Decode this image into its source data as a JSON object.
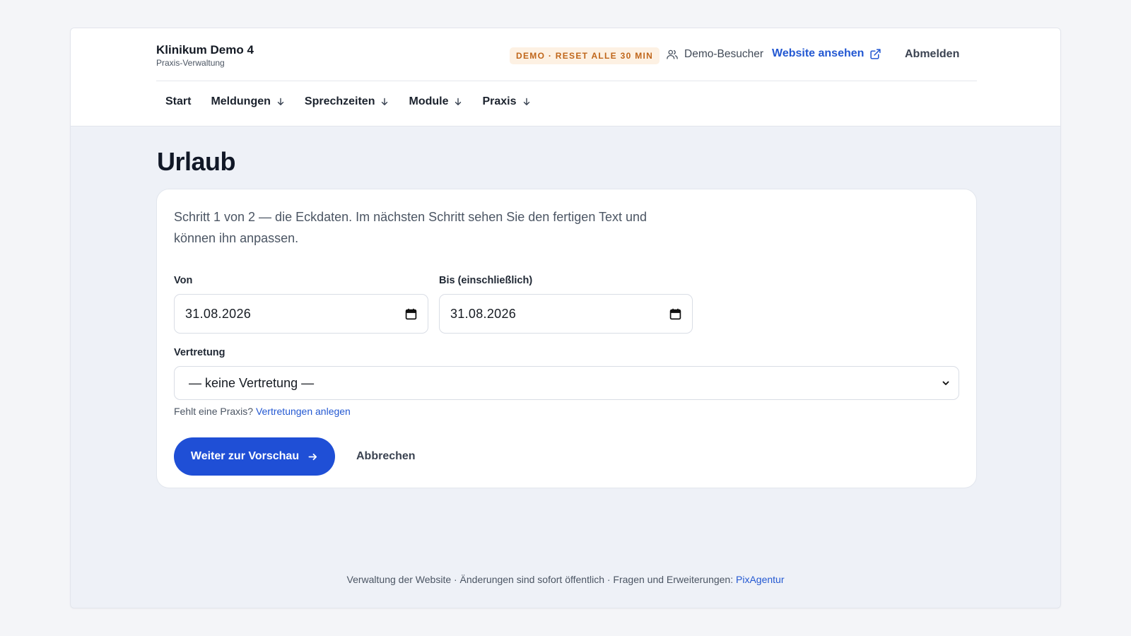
{
  "brand": {
    "title": "Klinikum Demo 4",
    "subtitle": "Praxis-Verwaltung"
  },
  "header": {
    "badge": "DEMO · RESET ALLE 30 MIN",
    "user": "Demo-Besucher",
    "site_link": "Website ansehen",
    "logout": "Abmelden"
  },
  "nav": {
    "items": [
      {
        "label": "Start"
      },
      {
        "label": "Meldungen"
      },
      {
        "label": "Sprechzeiten"
      },
      {
        "label": "Module"
      },
      {
        "label": "Praxis"
      }
    ]
  },
  "page": {
    "title": "Urlaub"
  },
  "form": {
    "intro": "Schritt 1 von 2 — die Eckdaten. Im nächsten Schritt sehen Sie den fertigen Text und können ihn anpassen.",
    "from_label": "Von",
    "from_value": "31.08.2026",
    "to_label": "Bis (einschließlich)",
    "to_value": "31.08.2026",
    "substitute_label": "Vertretung",
    "substitute_value": "— keine Vertretung —",
    "hint_text": "Fehlt eine Praxis?",
    "hint_link": "Vertretungen anlegen",
    "submit": "Weiter zur Vorschau",
    "cancel": "Abbrechen"
  },
  "footer": {
    "text": "Verwaltung der Website · Änderungen sind sofort öffentlich · Fragen und Erweiterungen:",
    "link": "PixAgentur"
  },
  "icons": {
    "user": "users-icon",
    "external": "external-link-icon",
    "nav_arrow": "arrow-down-icon",
    "calendar": "calendar-icon",
    "select": "chevron-down-icon",
    "submit": "arrow-right-icon"
  },
  "colors": {
    "accent": "#1f4fd6",
    "link": "#2358d2",
    "badge_bg": "#fdf1e3",
    "badge_text": "#c0661a",
    "page_bg": "#eef1f7"
  }
}
